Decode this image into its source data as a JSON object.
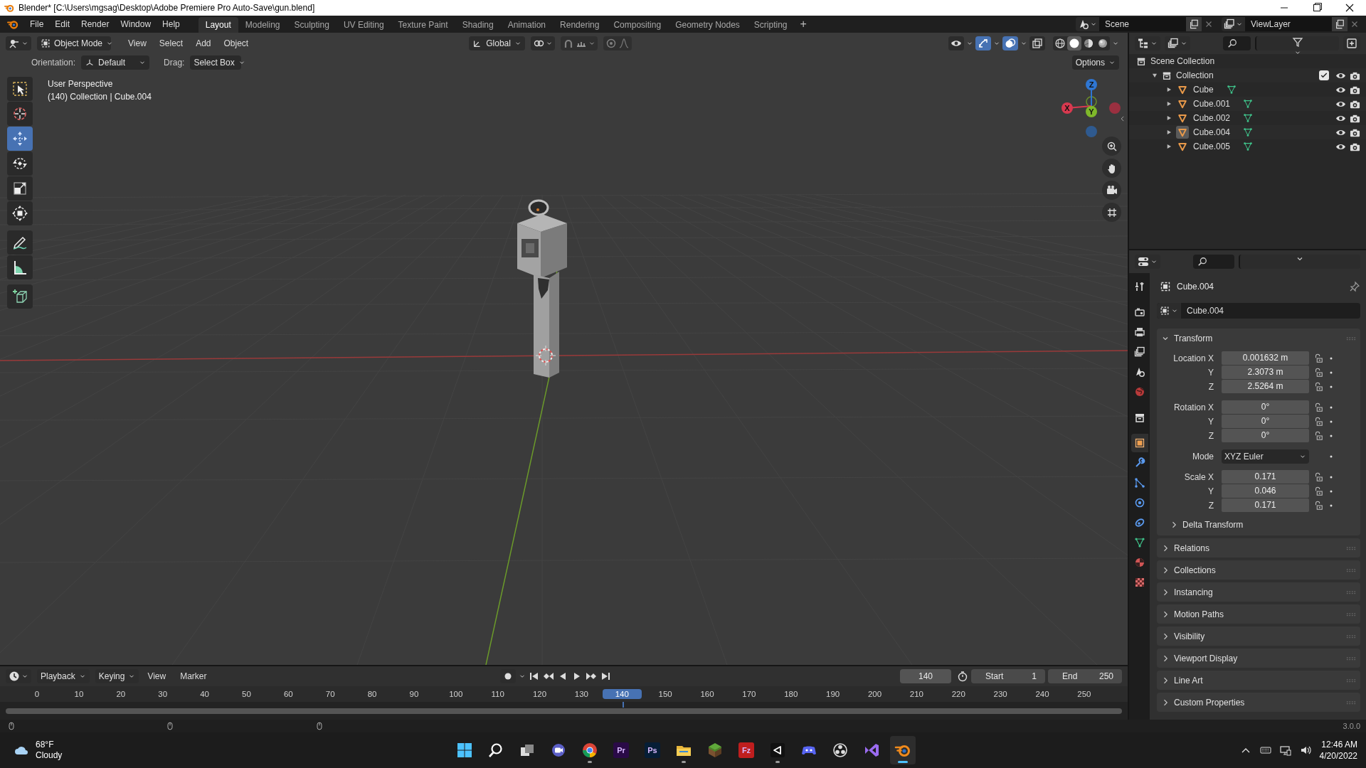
{
  "window": {
    "title": "Blender* [C:\\Users\\mgsag\\Desktop\\Adobe Premiere Pro Auto-Save\\gun.blend]"
  },
  "menu": [
    "File",
    "Edit",
    "Render",
    "Window",
    "Help"
  ],
  "workspaces": [
    {
      "label": "Layout",
      "selected": true
    },
    {
      "label": "Modeling",
      "selected": false
    },
    {
      "label": "Sculpting",
      "selected": false
    },
    {
      "label": "UV Editing",
      "selected": false
    },
    {
      "label": "Texture Paint",
      "selected": false
    },
    {
      "label": "Shading",
      "selected": false
    },
    {
      "label": "Animation",
      "selected": false
    },
    {
      "label": "Rendering",
      "selected": false
    },
    {
      "label": "Compositing",
      "selected": false
    },
    {
      "label": "Geometry Nodes",
      "selected": false
    },
    {
      "label": "Scripting",
      "selected": false
    }
  ],
  "add_workspace": "+",
  "scene": {
    "name": "Scene"
  },
  "view_layer": {
    "name": "ViewLayer"
  },
  "viewport": {
    "mode": "Object Mode",
    "menus": [
      "View",
      "Select",
      "Add",
      "Object"
    ],
    "transform_orientation": "Global",
    "toggles": [
      {
        "kind": "visibility",
        "on": false
      },
      {
        "kind": "gizmos",
        "on": true
      },
      {
        "kind": "overlays",
        "on": true
      },
      {
        "kind": "xray",
        "on": false
      }
    ],
    "shading": [
      {
        "kind": "wireframe",
        "selected": false
      },
      {
        "kind": "solid",
        "selected": true
      },
      {
        "kind": "material",
        "selected": false
      },
      {
        "kind": "rendered",
        "selected": false
      }
    ],
    "tool_settings": {
      "orientation_label": "Orientation:",
      "orientation": "Default",
      "drag_label": "Drag:",
      "drag": "Select Box",
      "options": "Options"
    },
    "info": [
      "User Perspective",
      "(140) Collection | Cube.004"
    ],
    "tools": [
      {
        "kind": "select_box",
        "selected": false
      },
      {
        "kind": "cursor",
        "selected": false
      },
      {
        "kind": "move",
        "selected": true
      },
      {
        "kind": "rotate",
        "selected": false
      },
      {
        "kind": "scale",
        "selected": false
      },
      {
        "kind": "transform",
        "selected": false
      },
      {
        "kind": "annotate",
        "selected": false
      },
      {
        "kind": "measure",
        "selected": false
      },
      {
        "kind": "add_cube",
        "selected": false
      }
    ],
    "gizmo": [
      {
        "label": "Z",
        "color": "#2f76d2"
      },
      {
        "label": "X",
        "color": "#d8394f"
      },
      {
        "label": "Y",
        "color": "#7fb82a"
      }
    ]
  },
  "outliner": {
    "root": {
      "label": "Scene Collection",
      "children": [
        {
          "label": "Collection",
          "expanded": true,
          "checked": true,
          "children": [
            {
              "label": "Cube",
              "expanded": false,
              "active": false
            },
            {
              "label": "Cube.001",
              "expanded": false,
              "active": false
            },
            {
              "label": "Cube.002",
              "expanded": false,
              "active": false
            },
            {
              "label": "Cube.004",
              "expanded": false,
              "active": true
            },
            {
              "label": "Cube.005",
              "expanded": false,
              "active": false
            }
          ]
        }
      ]
    }
  },
  "properties": {
    "tabs": [
      {
        "kind": "tool",
        "selected": false
      },
      {
        "kind": "render",
        "selected": false
      },
      {
        "kind": "output",
        "selected": false
      },
      {
        "kind": "view_layer",
        "selected": false
      },
      {
        "kind": "scene",
        "selected": false
      },
      {
        "kind": "world",
        "selected": false
      },
      {
        "kind": "collection",
        "selected": false
      },
      {
        "kind": "object",
        "selected": true
      },
      {
        "kind": "modifiers",
        "selected": false
      },
      {
        "kind": "particles",
        "selected": false
      },
      {
        "kind": "physics",
        "selected": false
      },
      {
        "kind": "constraints",
        "selected": false
      },
      {
        "kind": "data",
        "selected": false
      },
      {
        "kind": "material",
        "selected": false
      },
      {
        "kind": "texture",
        "selected": false
      }
    ],
    "object_name": "Cube.004",
    "datablock": "Cube.004",
    "panels": [
      {
        "label": "Transform",
        "expanded": true,
        "groups": [
          [
            {
              "label": "Location X",
              "value": "0.001632 m",
              "kind": "number"
            },
            {
              "label": "Y",
              "value": "2.3073 m",
              "kind": "number"
            },
            {
              "label": "Z",
              "value": "2.5264 m",
              "kind": "number"
            }
          ],
          [
            {
              "label": "Rotation X",
              "value": "0°",
              "kind": "number"
            },
            {
              "label": "Y",
              "value": "0°",
              "kind": "number"
            },
            {
              "label": "Z",
              "value": "0°",
              "kind": "number"
            }
          ],
          [
            {
              "label": "Mode",
              "value": "XYZ Euler",
              "kind": "dropdown"
            }
          ],
          [
            {
              "label": "Scale X",
              "value": "0.171",
              "kind": "number"
            },
            {
              "label": "Y",
              "value": "0.046",
              "kind": "number"
            },
            {
              "label": "Z",
              "value": "0.171",
              "kind": "number"
            }
          ]
        ],
        "subpanels": [
          {
            "label": "Delta Transform",
            "expanded": false
          }
        ]
      },
      {
        "label": "Relations",
        "expanded": false
      },
      {
        "label": "Collections",
        "expanded": false
      },
      {
        "label": "Instancing",
        "expanded": false
      },
      {
        "label": "Motion Paths",
        "expanded": false
      },
      {
        "label": "Visibility",
        "expanded": false
      },
      {
        "label": "Viewport Display",
        "expanded": false
      },
      {
        "label": "Line Art",
        "expanded": false
      },
      {
        "label": "Custom Properties",
        "expanded": false
      }
    ]
  },
  "timeline": {
    "menus": [
      {
        "label": "Playback",
        "kind": "dropdown"
      },
      {
        "label": "Keying",
        "kind": "dropdown"
      },
      {
        "label": "View",
        "kind": "menu"
      },
      {
        "label": "Marker",
        "kind": "menu"
      }
    ],
    "auto_keying": false,
    "current_frame": "140",
    "start_label": "Start",
    "start": "1",
    "end_label": "End",
    "end": "250",
    "ticks": [
      {
        "label": "0",
        "current": false
      },
      {
        "label": "10",
        "current": false
      },
      {
        "label": "20",
        "current": false
      },
      {
        "label": "30",
        "current": false
      },
      {
        "label": "40",
        "current": false
      },
      {
        "label": "50",
        "current": false
      },
      {
        "label": "60",
        "current": false
      },
      {
        "label": "70",
        "current": false
      },
      {
        "label": "80",
        "current": false
      },
      {
        "label": "90",
        "current": false
      },
      {
        "label": "100",
        "current": false
      },
      {
        "label": "110",
        "current": false
      },
      {
        "label": "120",
        "current": false
      },
      {
        "label": "130",
        "current": false
      },
      {
        "label": "140",
        "current": true
      },
      {
        "label": "150",
        "current": false
      },
      {
        "label": "160",
        "current": false
      },
      {
        "label": "170",
        "current": false
      },
      {
        "label": "180",
        "current": false
      },
      {
        "label": "190",
        "current": false
      },
      {
        "label": "200",
        "current": false
      },
      {
        "label": "210",
        "current": false
      },
      {
        "label": "220",
        "current": false
      },
      {
        "label": "230",
        "current": false
      },
      {
        "label": "240",
        "current": false
      },
      {
        "label": "250",
        "current": false
      }
    ]
  },
  "status_bar": {
    "version": "3.0.0"
  },
  "taskbar": {
    "weather": {
      "temperature": "68°F",
      "condition": "Cloudy"
    },
    "apps": [
      {
        "kind": "start",
        "running": false,
        "active": false
      },
      {
        "kind": "search",
        "running": false,
        "active": false
      },
      {
        "kind": "task_view",
        "running": false,
        "active": false
      },
      {
        "kind": "chat",
        "running": false,
        "active": false
      },
      {
        "kind": "browser",
        "running": true,
        "active": false
      },
      {
        "kind": "letter_tile",
        "glyph": "Pr",
        "color": "#2a0a47",
        "running": false,
        "active": false
      },
      {
        "kind": "letter_tile",
        "glyph": "Ps",
        "color": "#061e36",
        "running": false,
        "active": false
      },
      {
        "kind": "folder",
        "running": true,
        "active": false
      },
      {
        "kind": "grass_block",
        "running": false,
        "active": false
      },
      {
        "kind": "letter_tile",
        "glyph": "Fz",
        "color": "#bf1e1e",
        "running": false,
        "active": false
      },
      {
        "kind": "cube_logo",
        "running": true,
        "active": false
      },
      {
        "kind": "gamepad",
        "running": false,
        "active": false
      },
      {
        "kind": "aperture",
        "running": false,
        "active": false
      },
      {
        "kind": "infinity",
        "running": false,
        "active": false
      },
      {
        "kind": "blender",
        "running": true,
        "active": true
      }
    ],
    "time": "12:46 AM",
    "date": "4/20/2022"
  }
}
